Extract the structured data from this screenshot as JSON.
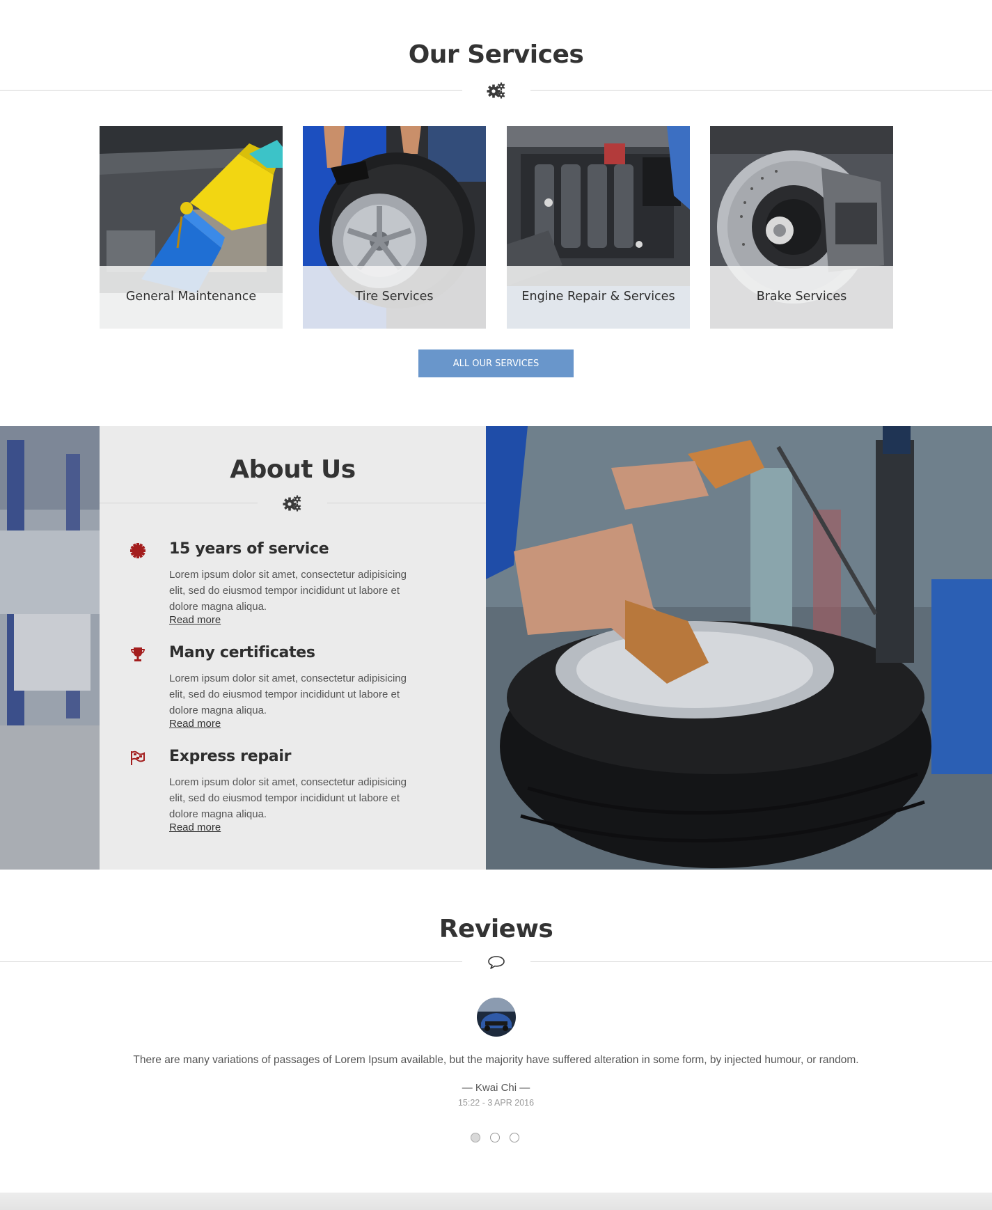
{
  "services": {
    "title": "Our Services",
    "divider_icon": "gears-icon",
    "cards": [
      {
        "label": "General Maintenance",
        "image": "oil-change-photo"
      },
      {
        "label": "Tire Services",
        "image": "tire-mechanic-photo"
      },
      {
        "label": "Engine Repair & Services",
        "image": "engine-bay-photo"
      },
      {
        "label": "Brake Services",
        "image": "brake-disc-photo"
      }
    ],
    "button_label": "ALL OUR SERVICES"
  },
  "about": {
    "title": "About Us",
    "divider_icon": "gears-icon",
    "features": [
      {
        "icon": "badge-icon",
        "title": "15 years of service",
        "text": "Lorem ipsum dolor sit amet, consectetur adipisicing elit, sed do eiusmod tempor incididunt ut labore et dolore magna aliqua.",
        "link": "Read more"
      },
      {
        "icon": "trophy-icon",
        "title": "Many certificates",
        "text": "Lorem ipsum dolor sit amet, consectetur adipisicing elit, sed do eiusmod tempor incididunt ut labore et dolore magna aliqua.",
        "link": "Read more"
      },
      {
        "icon": "racing-flag-icon",
        "title": "Express repair",
        "text": "Lorem ipsum dolor sit amet, consectetur adipisicing elit, sed do eiusmod tempor incididunt ut labore et dolore magna aliqua.",
        "link": "Read more"
      }
    ],
    "accent_color": "#a31d1d"
  },
  "reviews": {
    "title": "Reviews",
    "divider_icon": "speech-bubble-icon",
    "text": "There are many variations of passages of Lorem Ipsum available, but the majority have suffered alteration in some form, by injected humour, or random.",
    "author": "— Kwai Chi —",
    "date": "15:22 - 3 APR 2016",
    "slide_count": 3,
    "active_slide": 1
  },
  "colors": {
    "button": "#6996cb",
    "panel": "#ebebeb",
    "text": "#333333"
  }
}
